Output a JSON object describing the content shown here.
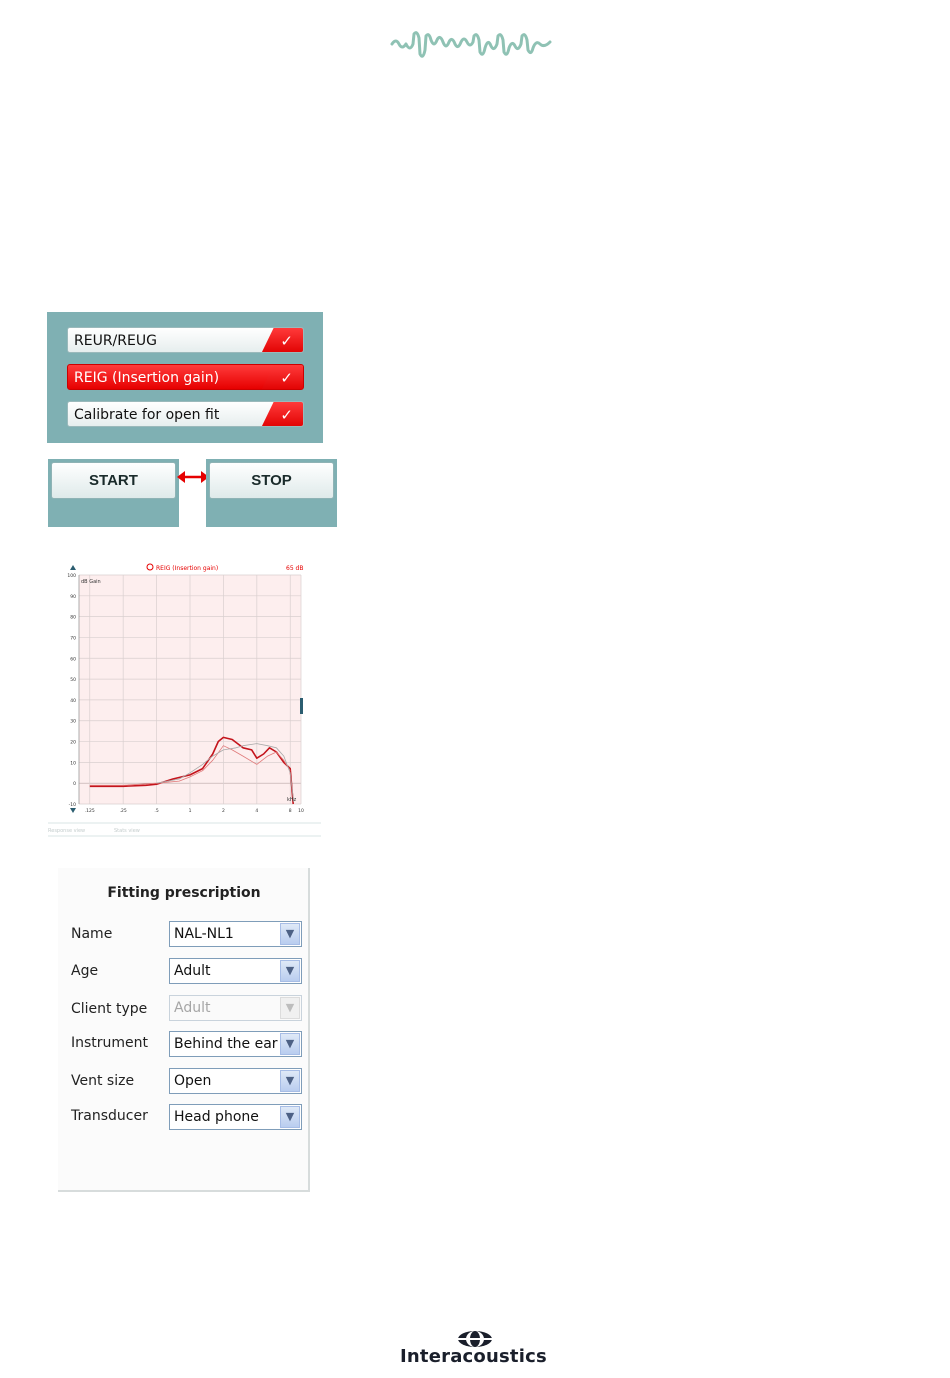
{
  "header": {
    "logo_icon": "wave-icon",
    "logo_color": "#8fc2b4"
  },
  "tests": {
    "items": [
      {
        "label": "REUR/REUG",
        "selected": false,
        "checked": true
      },
      {
        "label": "REIG (Insertion gain)",
        "selected": true,
        "checked": true
      },
      {
        "label": "Calibrate for open fit",
        "selected": false,
        "checked": true
      }
    ],
    "accent": "#e60000",
    "panel_color": "#7fb0b3"
  },
  "controls": {
    "start_label": "START",
    "stop_label": "STOP",
    "arrow_icon": "double-arrow-icon"
  },
  "graph": {
    "title": "REIG (Insertion gain)",
    "level": "65 dB",
    "ylabel": "dB Gain",
    "xunit": "kHz",
    "yticks": [
      "100",
      "90",
      "80",
      "70",
      "60",
      "50",
      "40",
      "30",
      "20",
      "10",
      "0",
      "-10"
    ],
    "xticks": [
      ".125",
      ".25",
      ".5",
      "1",
      "2",
      "4",
      "8",
      "10"
    ],
    "tabs": [
      "Response view",
      "Stats view"
    ]
  },
  "chart_data": {
    "type": "line",
    "title": "REIG (Insertion gain)",
    "xlabel": "kHz",
    "ylabel": "dB Gain",
    "xscale": "log",
    "xlim": [
      0.1,
      10
    ],
    "ylim": [
      -10,
      100
    ],
    "series": [
      {
        "x": [
          0.125,
          0.25,
          0.4,
          0.5,
          0.7,
          1,
          1.3,
          1.6,
          1.8,
          2,
          2.4,
          3,
          3.6,
          4,
          4.6,
          5.2,
          6,
          7,
          8,
          8.5
        ],
        "y": [
          -1.5,
          -1.5,
          -1,
          -0.5,
          2,
          4,
          7,
          14,
          20,
          22,
          21,
          17,
          16,
          12,
          14,
          17,
          15,
          10,
          7,
          -10
        ]
      },
      {
        "x": [
          0.125,
          0.25,
          0.5,
          0.8,
          1,
          1.3,
          1.6,
          2,
          2.4,
          3,
          4,
          5,
          6,
          7,
          8
        ],
        "y": [
          -1,
          -1,
          0,
          1,
          3,
          6,
          11,
          18,
          16,
          13,
          9,
          13,
          15,
          11,
          6
        ]
      },
      {
        "x": [
          0.5,
          0.8,
          1,
          1.3,
          1.6,
          2,
          2.6,
          3,
          4,
          5,
          6,
          7,
          8,
          8.6
        ],
        "y": [
          0,
          2,
          5,
          9,
          13,
          16,
          17,
          18,
          19,
          18,
          17,
          13,
          5,
          -9
        ]
      }
    ]
  },
  "prescription": {
    "title": "Fitting prescription",
    "fields": [
      {
        "label": "Name",
        "value": "NAL-NL1",
        "disabled": false
      },
      {
        "label": "Age",
        "value": "Adult",
        "disabled": false
      },
      {
        "label": "Client type",
        "value": "Adult",
        "disabled": true
      },
      {
        "label": "Instrument",
        "value": "Behind the ear",
        "disabled": false
      },
      {
        "label": "Vent size",
        "value": "Open",
        "disabled": false
      },
      {
        "label": "Transducer",
        "value": "Head phone",
        "disabled": false
      }
    ]
  },
  "footer": {
    "brand": "Interacoustics",
    "brand_icon": "interacoustics-logo-icon"
  }
}
